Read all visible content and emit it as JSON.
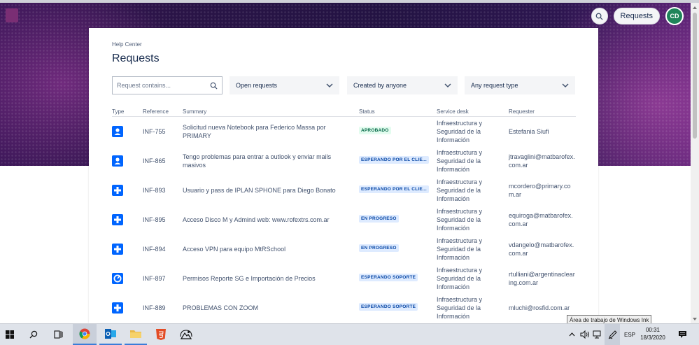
{
  "header": {
    "requests_button": "Requests",
    "avatar_initials": "CD"
  },
  "page": {
    "breadcrumb": "Help Center",
    "title": "Requests"
  },
  "filters": {
    "search_placeholder": "Request contains...",
    "status_filter": "Open requests",
    "creator_filter": "Created by anyone",
    "type_filter": "Any request type"
  },
  "table": {
    "columns": [
      "Type",
      "Reference",
      "Summary",
      "Status",
      "Service desk",
      "Requester"
    ],
    "rows": [
      {
        "icon": "person-icon",
        "reference": "INF-755",
        "summary": "Solicitud nueva Notebook para Federico Massa por PRIMARY",
        "status": "APROBADO",
        "desk": "Infraestructura y Seguridad de la Información",
        "requester": "Estefania Siufi"
      },
      {
        "icon": "person-icon",
        "reference": "INF-865",
        "summary": "Tengo problemas para entrar a outlook y enviar mails masivos",
        "status": "ESPERANDO POR EL CLIE...",
        "desk": "Infraestructura y Seguridad de la Información",
        "requester": "jtravaglini@matbarofex.com.ar"
      },
      {
        "icon": "plus-icon",
        "reference": "INF-893",
        "summary": "Usuario y pass de IPLAN SPHONE para Diego Bonato",
        "status": "ESPERANDO POR EL CLIE...",
        "desk": "Infraestructura y Seguridad de la Información",
        "requester": "mcordero@primary.com.ar"
      },
      {
        "icon": "plus-icon",
        "reference": "INF-895",
        "summary": "Acceso Disco M y Admind web: www.rofextrs.com.ar",
        "status": "EN PROGRESO",
        "desk": "Infraestructura y Seguridad de la Información",
        "requester": "equiroga@matbarofex.com.ar"
      },
      {
        "icon": "plus-icon",
        "reference": "INF-894",
        "summary": "Acceso VPN para equipo MtRSchool",
        "status": "EN PROGRESO",
        "desk": "Infraestructura y Seguridad de la Información",
        "requester": "vdangelo@matbarofex.com.ar"
      },
      {
        "icon": "gear-icon",
        "reference": "INF-897",
        "summary": "Permisos Reporte SG e Importación de Precios",
        "status": "ESPERANDO SOPORTE",
        "desk": "Infraestructura y Seguridad de la Información",
        "requester": "rtulliani@argentinaclearing.com.ar"
      },
      {
        "icon": "plus-icon",
        "reference": "INF-889",
        "summary": "PROBLEMAS CON ZOOM",
        "status": "ESPERANDO SOPORTE",
        "desk": "Infraestructura y Seguridad de la Información",
        "requester": "mluchi@rosfid.com.ar"
      }
    ]
  },
  "taskbar": {
    "tooltip": "Área de trabajo de Windows Ink",
    "language": "ESP",
    "time": "00:31",
    "date": "18/3/2020"
  },
  "colors": {
    "badge_green_bg": "#e3fcef",
    "badge_blue_bg": "#deebff",
    "type_icon_blue": "#0065ff",
    "avatar_green": "#1f845a"
  }
}
